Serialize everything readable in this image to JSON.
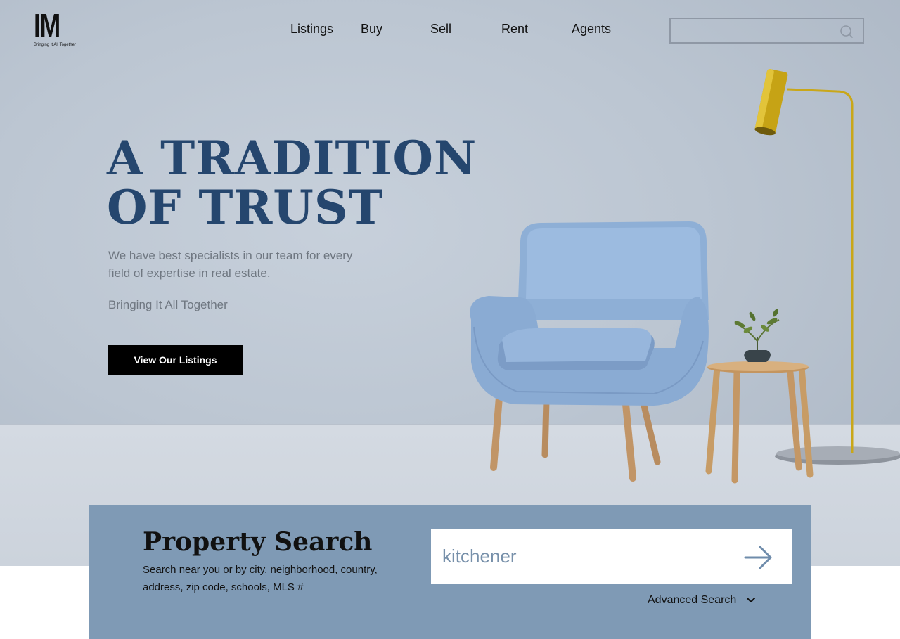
{
  "brand": {
    "logo_text": "IM",
    "tagline": "Bringing It All Together"
  },
  "nav": {
    "items": [
      {
        "label": "Listings",
        "icon": ""
      },
      {
        "label": "Buy"
      },
      {
        "label": "Sell"
      },
      {
        "label": "Rent"
      },
      {
        "label": "Agents"
      }
    ]
  },
  "top_search": {
    "value": "",
    "placeholder": "",
    "icon": "search-icon"
  },
  "hero": {
    "headline_line1": "A TRADITION",
    "headline_line2": "OF TRUST",
    "description": "We have best specialists in our team for every field of expertise in real estate.",
    "tagline": "Bringing It All Together",
    "cta_label": "View Our Listings"
  },
  "property_search": {
    "title": "Property Search",
    "subtitle": "Search near you or by city, neighborhood, country, address, zip code, schools, MLS #",
    "input_value": "kitchener",
    "submit_icon": "arrow-right-icon",
    "advanced_label": "Advanced Search",
    "advanced_icon": "chevron-down-icon"
  },
  "colors": {
    "headline": "#25466e",
    "panel": "#7f9ab5",
    "cta_bg": "#000000",
    "chair": "#8fb0d6",
    "lamp": "#c9a719"
  }
}
